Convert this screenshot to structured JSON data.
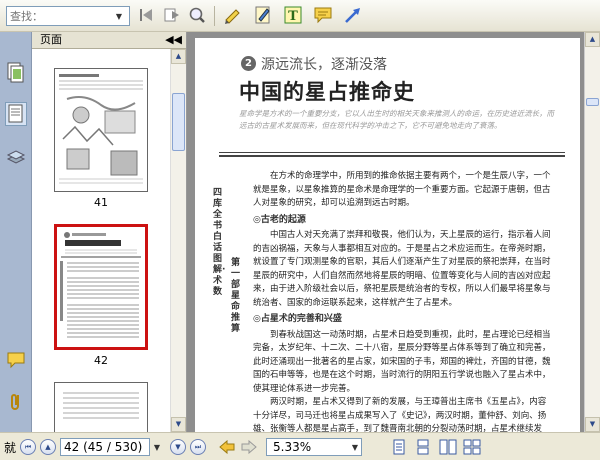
{
  "toolbar": {
    "search_placeholder": "查找：",
    "icons": [
      "first-page-icon",
      "next-page-icon",
      "zoom-icon",
      "highlight-icon",
      "note-edit-icon",
      "text-tool-icon",
      "comment-icon",
      "arrow-icon"
    ]
  },
  "pages_panel": {
    "title": "页面",
    "thumbnails": [
      {
        "label": "41",
        "selected": false
      },
      {
        "label": "42",
        "selected": true
      },
      {
        "label": "",
        "selected": false
      }
    ]
  },
  "document": {
    "chapter_number": "2",
    "subtitle": "源远流长，逐渐没落",
    "title": "中国的星占推命史",
    "intro": "星命学是方术的一个重要分支，它以人出生时的相关天象来推测人的命运，在历史进近流长，而远古的古星术发展而来，但在现代科学的冲击之下，它不可避免地走向了衰落。",
    "side_text_1": "四库全书白话图解·术数",
    "side_text_2": "第一部 星命推算",
    "p1": "在方术的命理学中，所用到的推命依据主要有两个，一个是生辰八字，一个就是星象，以星象推算的星命术是命理学的一个重要方面。它起源于唐朝，但古人对星象的研究，却可以追溯到远古时期。",
    "h1": "◎古老的起源",
    "p2": "中国古人对天充满了崇拜和敬畏，他们认为，天上星辰的运行，指示着人间的吉凶祸福，天象与人事都相互对应的。于是星占之术应运而生。在帝尧时期，就设置了专门观测星象的官职，其后人们逐渐产生了对星辰的祭祀崇拜，在当时星辰的研究中，人们自然而然地将星辰的明暗、位置等变化与人间的吉凶对应起来，由于进入阶级社会以后，祭祀星辰是统治者的专权，所以人们最早将星象与统治者、国家的命运联系起来，这样就产生了占星术。",
    "h2": "◎占星术的完善和兴盛",
    "p3": "到春秋战国这一动荡时期，占星术日趋受到重视，此时，星占理论已经相当完备，太岁纪年、十二次、二十八宿，星辰分野等星占体系等到了确立和完善，此时还涌现出一批著名的星占家，如宋国的子韦，郑国的裨灶，齐国的甘德，魏国的石申等等，也是在这个时期，当时流行的阴阳五行学说也融入了星占术中，使其理论体系进一步完善。",
    "p4": "两汉时期，星占术又得到了新的发展，与王璋普出主席书《五星占》，内容十分详尽，司马迁也将星占成果写入了《史记》，两汉时期，董仲舒、刘向、扬雄、张衡等人都是星占高手，到了魏晋南北朝的分裂动荡时期，占星术继续发展，但并没有质的突破，统治者虽然继续利用它，但对其已经不太重视了。"
  },
  "statusbar": {
    "page_display": "42 (45 / 530)",
    "zoom": "5.33%"
  }
}
